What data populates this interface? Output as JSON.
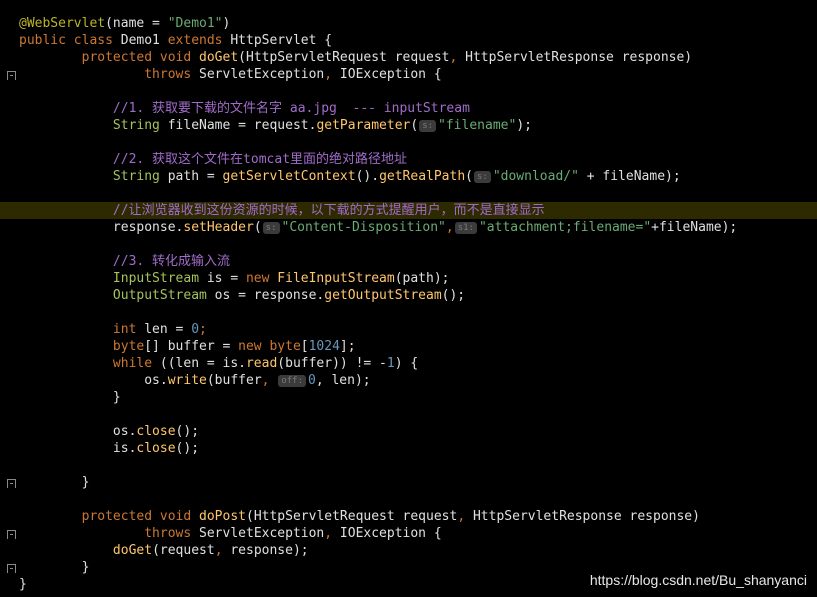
{
  "colors": {
    "background": "#000000",
    "keyword": "#cc7832",
    "string": "#6aab73",
    "comment": "#a06cc9",
    "method": "#ffc66d",
    "number": "#6897bb",
    "annotation": "#bbb529",
    "highlight_line": "#2e2a00"
  },
  "icons": {
    "gutter_hint": "lightbulb-icon",
    "fold": "fold-marker-icon"
  },
  "code": {
    "l1_annotation": "@WebServlet",
    "l1_rest_a": "(name = ",
    "l1_string": "\"Demo1\"",
    "l1_rest_b": ")",
    "l2_kw": "public class",
    "l2_name": " Demo1 ",
    "l2_kw2": "extends",
    "l2_rest": " HttpServlet {",
    "l3_kw": "protected void",
    "l3_method": "doGet",
    "l3_rest_a": "(HttpServletRequest request",
    "l3_comma": ",",
    "l3_rest_b": " HttpServletResponse response)",
    "l4_kw": "throws",
    "l4_rest_a": " ServletException",
    "l4_comma": ",",
    "l4_rest_b": " IOException {",
    "c1": "//1. 获取要下载的文件名字 aa.jpg  --- inputStream",
    "l6_type": "String",
    "l6_a": " fileName = request.",
    "l6_method": "getParameter",
    "l6_b": "(",
    "l6_hint": "s:",
    "l6_str": "\"filename\"",
    "l6_c": ");",
    "c2": "//2. 获取这个文件在tomcat里面的绝对路径地址",
    "l8_type": "String",
    "l8_a": " path = ",
    "l8_m1": "getServletContext",
    "l8_b": "().",
    "l8_m2": "getRealPath",
    "l8_c": "(",
    "l8_hint": "s:",
    "l8_str": "\"download/\"",
    "l8_d": " + fileName);",
    "c3": "//让浏览器收到这份资源的时候，以下载的方式提醒用户，而不是直接显示",
    "l10_a": "response.",
    "l10_method": "setHeader",
    "l10_b": "(",
    "l10_hint1": "s:",
    "l10_str1": "\"Content-Disposition\"",
    "l10_comma": ",",
    "l10_hint2": "s1:",
    "l10_str2": "\"attachment;filename=\"",
    "l10_c": "+fileName);",
    "c4": "//3. 转化成输入流",
    "l12_type": "InputStream",
    "l12_a": " is = ",
    "l12_kw": "new",
    "l12_b": " ",
    "l12_class": "FileInputStream",
    "l12_c": "(path);",
    "l13_type": "OutputStream",
    "l13_a": " os = response.",
    "l13_method": "getOutputStream",
    "l13_b": "();",
    "l15_kw": "int",
    "l15_a": " len = ",
    "l15_num": "0",
    "l15_b": ";",
    "l16_kw": "byte",
    "l16_a": "[] buffer = ",
    "l16_kw2": "new",
    "l16_kw3": " byte",
    "l16_b": "[",
    "l16_num": "1024",
    "l16_c": "];",
    "l17_kw": "while",
    "l17_a": " ((len = is.",
    "l17_method": "read",
    "l17_b": "(buffer)) != -",
    "l17_num": "1",
    "l17_c": ") {",
    "l18_a": "os.",
    "l18_method": "write",
    "l18_b": "(buffer",
    "l18_comma": ",",
    "l18_hint": "off:",
    "l18_num": "0",
    "l18_c": ", len);",
    "l19": "}",
    "l21_a": "os.",
    "l21_method": "close",
    "l21_b": "();",
    "l22_a": "is.",
    "l22_method": "close",
    "l22_b": "();",
    "l24": "}",
    "l26_kw": "protected void",
    "l26_method": "doPost",
    "l26_rest_a": "(HttpServletRequest request",
    "l26_comma": ",",
    "l26_rest_b": " HttpServletResponse response)",
    "l27_kw": "throws",
    "l27_rest_a": " ServletException",
    "l27_comma": ",",
    "l27_rest_b": " IOException {",
    "l28_method": "doGet",
    "l28_a": "(request",
    "l28_comma": ",",
    "l28_b": " response);",
    "l29": "}",
    "l30": "}"
  },
  "watermark": "https://blog.csdn.net/Bu_shanyanci"
}
